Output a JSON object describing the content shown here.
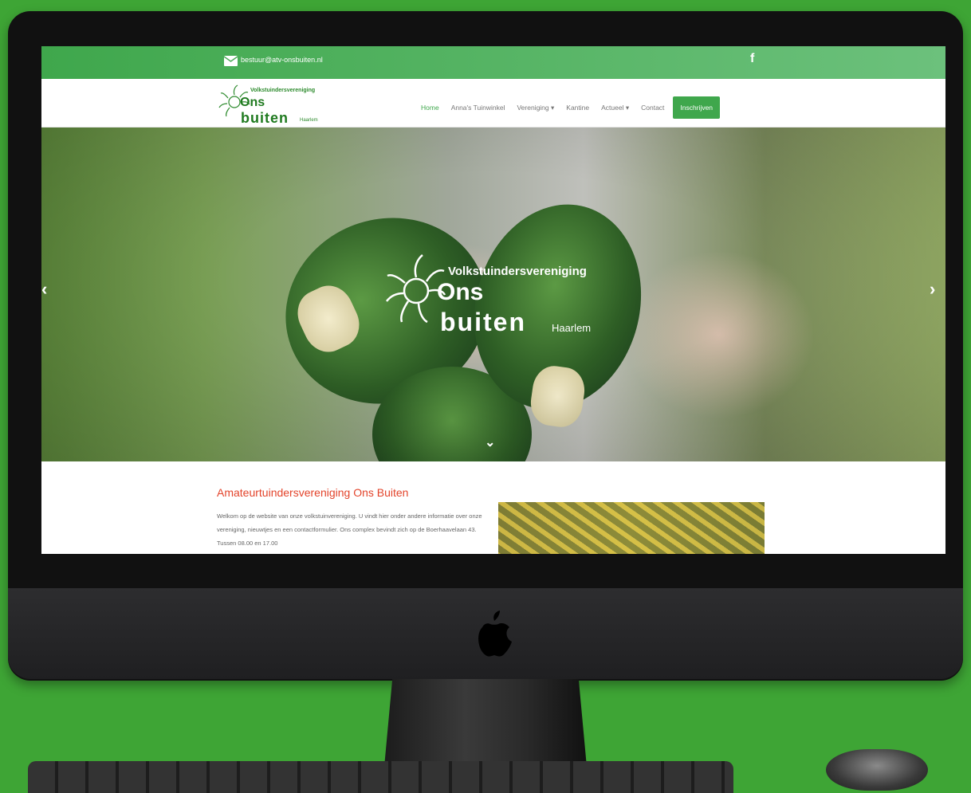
{
  "topbar": {
    "email": "bestuur@atv-onsbuiten.nl",
    "mail_icon": "envelope-icon",
    "social_icon": "facebook-icon",
    "social_label": "f"
  },
  "logo": {
    "line1": "Volkstuindersvereniging",
    "line2": "Ons",
    "line3": "buiten",
    "line4": "Haarlem"
  },
  "nav": {
    "items": [
      "Home",
      "Anna's Tuinwinkel",
      "Vereniging ▾",
      "Kantine",
      "Actueel ▾",
      "Contact"
    ],
    "active_index": 0,
    "cta": "Inschrijven"
  },
  "hero": {
    "logo_line1": "Volkstuindersvereniging",
    "logo_line2": "Ons",
    "logo_line3": "buiten",
    "logo_line4": "Haarlem",
    "prev_icon": "‹",
    "next_icon": "›",
    "scroll_icon": "⌄"
  },
  "content": {
    "heading": "Amateurtuindersvereniging Ons Buiten",
    "paragraph": "Welkom op de website van onze volkstuinvereniging. U vindt hier onder andere informatie over onze vereniging, nieuwtjes en een contactformulier. Ons complex bevindt zich op de Boerhaavelaan 43. Tussen 08.00 en 17.00"
  },
  "colors": {
    "green": "#3fa74c",
    "background": "#3ea535",
    "heading": "#e3442b"
  }
}
